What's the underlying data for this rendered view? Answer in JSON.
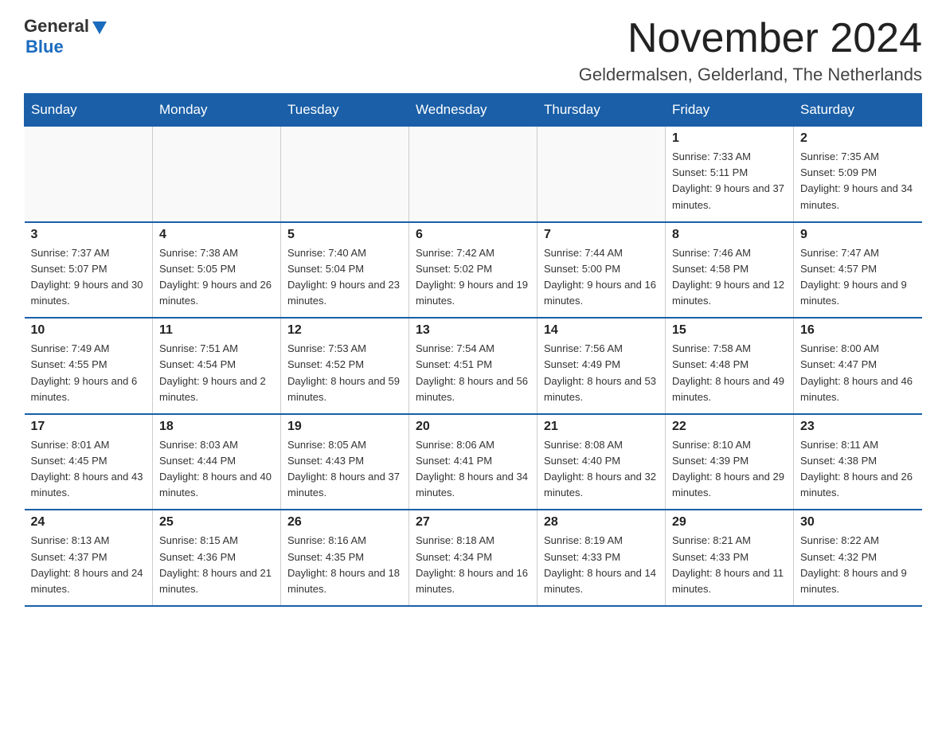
{
  "logo": {
    "text_general": "General",
    "text_blue": "Blue",
    "triangle_symbol": "▶"
  },
  "title": {
    "month": "November 2024",
    "location": "Geldermalsen, Gelderland, The Netherlands"
  },
  "weekdays": [
    "Sunday",
    "Monday",
    "Tuesday",
    "Wednesday",
    "Thursday",
    "Friday",
    "Saturday"
  ],
  "weeks": [
    [
      {
        "day": "",
        "info": ""
      },
      {
        "day": "",
        "info": ""
      },
      {
        "day": "",
        "info": ""
      },
      {
        "day": "",
        "info": ""
      },
      {
        "day": "",
        "info": ""
      },
      {
        "day": "1",
        "info": "Sunrise: 7:33 AM\nSunset: 5:11 PM\nDaylight: 9 hours and 37 minutes."
      },
      {
        "day": "2",
        "info": "Sunrise: 7:35 AM\nSunset: 5:09 PM\nDaylight: 9 hours and 34 minutes."
      }
    ],
    [
      {
        "day": "3",
        "info": "Sunrise: 7:37 AM\nSunset: 5:07 PM\nDaylight: 9 hours and 30 minutes."
      },
      {
        "day": "4",
        "info": "Sunrise: 7:38 AM\nSunset: 5:05 PM\nDaylight: 9 hours and 26 minutes."
      },
      {
        "day": "5",
        "info": "Sunrise: 7:40 AM\nSunset: 5:04 PM\nDaylight: 9 hours and 23 minutes."
      },
      {
        "day": "6",
        "info": "Sunrise: 7:42 AM\nSunset: 5:02 PM\nDaylight: 9 hours and 19 minutes."
      },
      {
        "day": "7",
        "info": "Sunrise: 7:44 AM\nSunset: 5:00 PM\nDaylight: 9 hours and 16 minutes."
      },
      {
        "day": "8",
        "info": "Sunrise: 7:46 AM\nSunset: 4:58 PM\nDaylight: 9 hours and 12 minutes."
      },
      {
        "day": "9",
        "info": "Sunrise: 7:47 AM\nSunset: 4:57 PM\nDaylight: 9 hours and 9 minutes."
      }
    ],
    [
      {
        "day": "10",
        "info": "Sunrise: 7:49 AM\nSunset: 4:55 PM\nDaylight: 9 hours and 6 minutes."
      },
      {
        "day": "11",
        "info": "Sunrise: 7:51 AM\nSunset: 4:54 PM\nDaylight: 9 hours and 2 minutes."
      },
      {
        "day": "12",
        "info": "Sunrise: 7:53 AM\nSunset: 4:52 PM\nDaylight: 8 hours and 59 minutes."
      },
      {
        "day": "13",
        "info": "Sunrise: 7:54 AM\nSunset: 4:51 PM\nDaylight: 8 hours and 56 minutes."
      },
      {
        "day": "14",
        "info": "Sunrise: 7:56 AM\nSunset: 4:49 PM\nDaylight: 8 hours and 53 minutes."
      },
      {
        "day": "15",
        "info": "Sunrise: 7:58 AM\nSunset: 4:48 PM\nDaylight: 8 hours and 49 minutes."
      },
      {
        "day": "16",
        "info": "Sunrise: 8:00 AM\nSunset: 4:47 PM\nDaylight: 8 hours and 46 minutes."
      }
    ],
    [
      {
        "day": "17",
        "info": "Sunrise: 8:01 AM\nSunset: 4:45 PM\nDaylight: 8 hours and 43 minutes."
      },
      {
        "day": "18",
        "info": "Sunrise: 8:03 AM\nSunset: 4:44 PM\nDaylight: 8 hours and 40 minutes."
      },
      {
        "day": "19",
        "info": "Sunrise: 8:05 AM\nSunset: 4:43 PM\nDaylight: 8 hours and 37 minutes."
      },
      {
        "day": "20",
        "info": "Sunrise: 8:06 AM\nSunset: 4:41 PM\nDaylight: 8 hours and 34 minutes."
      },
      {
        "day": "21",
        "info": "Sunrise: 8:08 AM\nSunset: 4:40 PM\nDaylight: 8 hours and 32 minutes."
      },
      {
        "day": "22",
        "info": "Sunrise: 8:10 AM\nSunset: 4:39 PM\nDaylight: 8 hours and 29 minutes."
      },
      {
        "day": "23",
        "info": "Sunrise: 8:11 AM\nSunset: 4:38 PM\nDaylight: 8 hours and 26 minutes."
      }
    ],
    [
      {
        "day": "24",
        "info": "Sunrise: 8:13 AM\nSunset: 4:37 PM\nDaylight: 8 hours and 24 minutes."
      },
      {
        "day": "25",
        "info": "Sunrise: 8:15 AM\nSunset: 4:36 PM\nDaylight: 8 hours and 21 minutes."
      },
      {
        "day": "26",
        "info": "Sunrise: 8:16 AM\nSunset: 4:35 PM\nDaylight: 8 hours and 18 minutes."
      },
      {
        "day": "27",
        "info": "Sunrise: 8:18 AM\nSunset: 4:34 PM\nDaylight: 8 hours and 16 minutes."
      },
      {
        "day": "28",
        "info": "Sunrise: 8:19 AM\nSunset: 4:33 PM\nDaylight: 8 hours and 14 minutes."
      },
      {
        "day": "29",
        "info": "Sunrise: 8:21 AM\nSunset: 4:33 PM\nDaylight: 8 hours and 11 minutes."
      },
      {
        "day": "30",
        "info": "Sunrise: 8:22 AM\nSunset: 4:32 PM\nDaylight: 8 hours and 9 minutes."
      }
    ]
  ],
  "colors": {
    "header_bg": "#1a5fa8",
    "header_text": "#ffffff",
    "border": "#1a5fa8"
  }
}
